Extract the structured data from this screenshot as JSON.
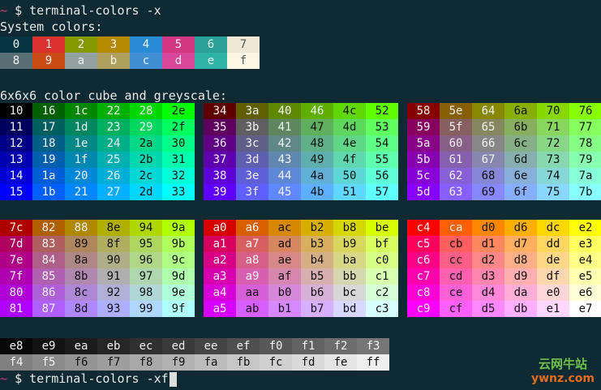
{
  "prompt1": {
    "tilde": "~",
    "dollar": "$",
    "command": "terminal-colors -x"
  },
  "system_label": "System colors:",
  "system_row1": [
    "0",
    "1",
    "2",
    "3",
    "4",
    "5",
    "6",
    "7"
  ],
  "system_row2": [
    "8",
    "9",
    "a",
    "b",
    "c",
    "d",
    "e",
    "f"
  ],
  "cube_label": "6x6x6 color cube and greyscale:",
  "grey_row1": [
    "e8",
    "e9",
    "ea",
    "eb",
    "ec",
    "ed",
    "ee",
    "ef",
    "f0",
    "f1",
    "f2",
    "f3"
  ],
  "grey_row2": [
    "f4",
    "f5",
    "f6",
    "f7",
    "f8",
    "f9",
    "fa",
    "fb",
    "fc",
    "fd",
    "fe",
    "ff"
  ],
  "prompt2": {
    "tilde": "~",
    "dollar": "$",
    "command": "terminal-colors -xf"
  },
  "watermark": {
    "line1": "云网牛站",
    "line2": "ywnz.com"
  },
  "colors": {
    "background": "#0f2a33",
    "system": [
      "#073642",
      "#dc322f",
      "#859900",
      "#b58900",
      "#268bd2",
      "#d33682",
      "#2aa198",
      "#eee8d5",
      "#586e75",
      "#cb4b16",
      "#93a1a1",
      "#b0a060",
      "#3f8fd2",
      "#d8479a",
      "#2fb3a8",
      "#fdf6e3"
    ]
  }
}
